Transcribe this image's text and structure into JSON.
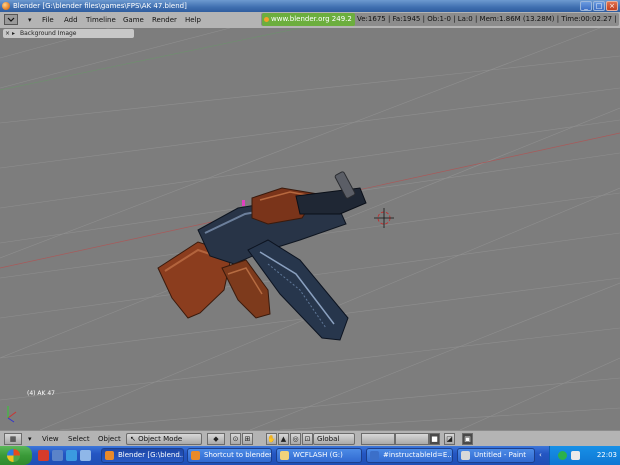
{
  "window": {
    "title": "Blender [G:\\blender files\\games\\FPS\\AK 47.blend]",
    "buttons": [
      "_",
      "□",
      "×"
    ]
  },
  "menubar": {
    "items": [
      "File",
      "Add",
      "Timeline",
      "Game",
      "Render",
      "Help"
    ],
    "url": "www.blender.org 249.2",
    "stats": "Ve:1675 | Fa:1945 | Ob:1-0 | La:0 | Mem:1.86M (13.28M) | Time:00:02.27 |"
  },
  "viewport": {
    "panel_label": "Background Image",
    "object_label": "(4) AK 47"
  },
  "bottombar": {
    "menus": [
      "View",
      "Select",
      "Object"
    ],
    "mode": "Object Mode",
    "orientation": "Global"
  },
  "taskbar": {
    "tasks": [
      {
        "label": "Blender [G:\\blend..."
      },
      {
        "label": "Shortcut to blender"
      },
      {
        "label": "WCFLASH (G:)"
      },
      {
        "label": "#instructableId=E..."
      },
      {
        "label": "Untitled - Paint"
      }
    ],
    "clock": "22:03"
  }
}
